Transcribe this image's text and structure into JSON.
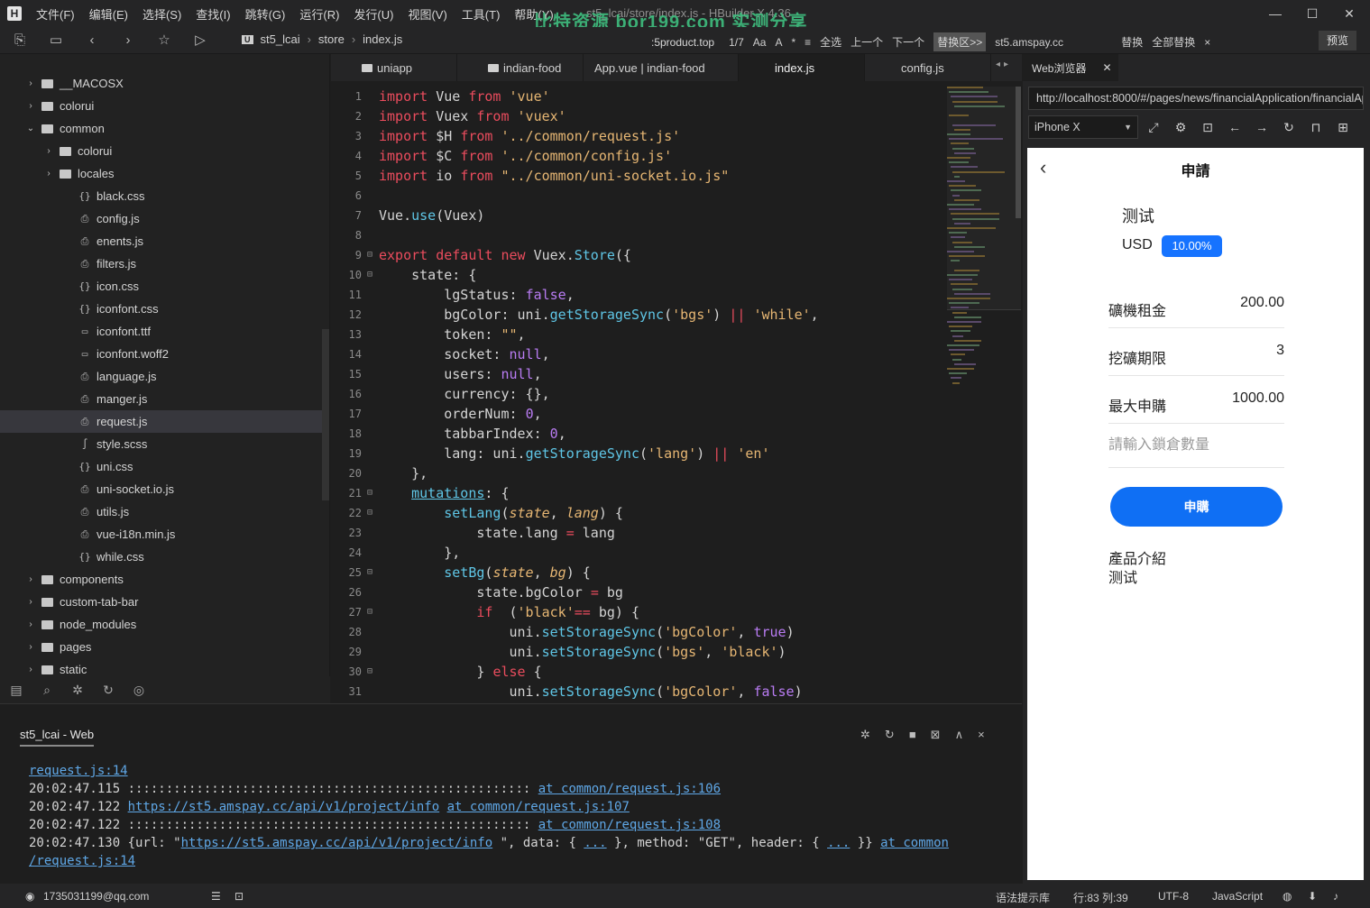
{
  "titlebar": {
    "app_logo": "H",
    "menus": [
      "文件(F)",
      "编辑(E)",
      "选择(S)",
      "查找(I)",
      "跳转(G)",
      "运行(R)",
      "发行(U)",
      "视图(V)",
      "工具(T)",
      "帮助(Y)"
    ],
    "window_title": "st5_lcai/store/index.js - HBuilder X 4.36",
    "watermark": "比特资源 bor199.com 实测分享"
  },
  "toolbar": {
    "breadcrumbs": [
      "st5_lcai",
      "store",
      "index.js"
    ],
    "find_term": ":5product.top",
    "find_count": "1/7",
    "case_btn": "Aa",
    "word_btn": "A",
    "regex_btn": "*",
    "select_all": "全选",
    "prev": "上一个",
    "next": "下一个",
    "replace_area": "替换区>>",
    "replace_term": "st5.amspay.cc",
    "replace": "替换",
    "replace_all": "全部替换",
    "close": "×",
    "preview": "预览"
  },
  "sidebar": {
    "items": [
      {
        "label": "__MACOSX",
        "type": "folder",
        "depth": 0,
        "expanded": false
      },
      {
        "label": "colorui",
        "type": "folder",
        "depth": 0,
        "expanded": false
      },
      {
        "label": "common",
        "type": "folder",
        "depth": 0,
        "expanded": true
      },
      {
        "label": "colorui",
        "type": "folder",
        "depth": 1,
        "expanded": false
      },
      {
        "label": "locales",
        "type": "folder",
        "depth": 1,
        "expanded": false
      },
      {
        "label": "black.css",
        "type": "css",
        "depth": 1
      },
      {
        "label": "config.js",
        "type": "js",
        "depth": 1
      },
      {
        "label": "enents.js",
        "type": "js",
        "depth": 1
      },
      {
        "label": "filters.js",
        "type": "js",
        "depth": 1
      },
      {
        "label": "icon.css",
        "type": "css",
        "depth": 1
      },
      {
        "label": "iconfont.css",
        "type": "css",
        "depth": 1
      },
      {
        "label": "iconfont.ttf",
        "type": "file",
        "depth": 1
      },
      {
        "label": "iconfont.woff2",
        "type": "file",
        "depth": 1
      },
      {
        "label": "language.js",
        "type": "js",
        "depth": 1
      },
      {
        "label": "manger.js",
        "type": "js",
        "depth": 1
      },
      {
        "label": "request.js",
        "type": "js",
        "depth": 1,
        "selected": true
      },
      {
        "label": "style.scss",
        "type": "scss",
        "depth": 1
      },
      {
        "label": "uni.css",
        "type": "css",
        "depth": 1
      },
      {
        "label": "uni-socket.io.js",
        "type": "js",
        "depth": 1
      },
      {
        "label": "utils.js",
        "type": "js",
        "depth": 1
      },
      {
        "label": "vue-i18n.min.js",
        "type": "js",
        "depth": 1
      },
      {
        "label": "while.css",
        "type": "css",
        "depth": 1
      },
      {
        "label": "components",
        "type": "folder",
        "depth": 0,
        "expanded": false
      },
      {
        "label": "custom-tab-bar",
        "type": "folder",
        "depth": 0,
        "expanded": false
      },
      {
        "label": "node_modules",
        "type": "folder",
        "depth": 0,
        "expanded": false
      },
      {
        "label": "pages",
        "type": "folder",
        "depth": 0,
        "expanded": false
      },
      {
        "label": "static",
        "type": "folder",
        "depth": 0,
        "expanded": false
      }
    ]
  },
  "tabs": [
    {
      "label": "uniapp",
      "folder": true
    },
    {
      "label": "indian-food",
      "folder": true
    },
    {
      "label": "App.vue | indian-food",
      "folder": false
    },
    {
      "label": "index.js",
      "folder": false,
      "active": true
    },
    {
      "label": "config.js",
      "folder": false
    }
  ],
  "code": [
    {
      "n": "1",
      "fold": "",
      "tokens": [
        [
          "kw",
          "import"
        ],
        [
          "",
          "Vue "
        ],
        [
          "kw",
          "from"
        ],
        [
          "",
          ""
        ],
        [
          "str",
          "'vue'"
        ]
      ]
    },
    {
      "n": "2",
      "fold": "",
      "tokens": [
        [
          "kw",
          "import"
        ],
        [
          "",
          "Vuex "
        ],
        [
          "kw",
          "from"
        ],
        [
          "",
          ""
        ],
        [
          "str",
          "'vuex'"
        ]
      ]
    },
    {
      "n": "3",
      "fold": "",
      "tokens": [
        [
          "kw",
          "import"
        ],
        [
          "",
          "$H "
        ],
        [
          "kw",
          "from"
        ],
        [
          "",
          ""
        ],
        [
          "str",
          "'../common/request.js'"
        ]
      ]
    },
    {
      "n": "4",
      "fold": "",
      "tokens": [
        [
          "kw",
          "import"
        ],
        [
          "",
          "$C "
        ],
        [
          "kw",
          "from"
        ],
        [
          "",
          ""
        ],
        [
          "str",
          "'../common/config.js'"
        ]
      ]
    },
    {
      "n": "5",
      "fold": "",
      "tokens": [
        [
          "kw",
          "import"
        ],
        [
          "",
          "io "
        ],
        [
          "kw",
          "from"
        ],
        [
          "",
          ""
        ],
        [
          "str",
          "\"../common/uni-socket.io.js\""
        ]
      ]
    },
    {
      "n": "6",
      "fold": "",
      "tokens": []
    },
    {
      "n": "7",
      "fold": "",
      "tokens": [
        [
          "",
          "Vue."
        ],
        [
          "fn",
          "use"
        ],
        [
          "",
          "(Vuex)"
        ]
      ]
    },
    {
      "n": "8",
      "fold": "",
      "tokens": []
    },
    {
      "n": "9",
      "fold": "⊟",
      "tokens": [
        [
          "kw",
          "export default new"
        ],
        [
          "",
          "Vuex."
        ],
        [
          "fn",
          "Store"
        ],
        [
          "",
          "({"
        ]
      ]
    },
    {
      "n": "10",
      "fold": "⊟",
      "tokens": [
        [
          "",
          "    state: {"
        ]
      ]
    },
    {
      "n": "11",
      "fold": "",
      "tokens": [
        [
          "",
          "        lgStatus: "
        ],
        [
          "lit",
          "false"
        ],
        [
          "",
          ","
        ]
      ]
    },
    {
      "n": "12",
      "fold": "",
      "tokens": [
        [
          "",
          "        bgColor: uni."
        ],
        [
          "fn",
          "getStorageSync"
        ],
        [
          "",
          "("
        ],
        [
          "str",
          "'bgs'"
        ],
        [
          "",
          ") "
        ],
        [
          "op",
          "||"
        ],
        [
          "",
          ""
        ],
        [
          "str",
          "'while'"
        ],
        [
          "",
          ","
        ]
      ]
    },
    {
      "n": "13",
      "fold": "",
      "tokens": [
        [
          "",
          "        token: "
        ],
        [
          "str",
          "\"\""
        ],
        [
          "",
          ","
        ]
      ]
    },
    {
      "n": "14",
      "fold": "",
      "tokens": [
        [
          "",
          "        socket: "
        ],
        [
          "lit",
          "null"
        ],
        [
          "",
          ","
        ]
      ]
    },
    {
      "n": "15",
      "fold": "",
      "tokens": [
        [
          "",
          "        users: "
        ],
        [
          "lit",
          "null"
        ],
        [
          "",
          ","
        ]
      ]
    },
    {
      "n": "16",
      "fold": "",
      "tokens": [
        [
          "",
          "        currency: {},"
        ]
      ]
    },
    {
      "n": "17",
      "fold": "",
      "tokens": [
        [
          "",
          "        orderNum: "
        ],
        [
          "lit",
          "0"
        ],
        [
          "",
          ","
        ]
      ]
    },
    {
      "n": "18",
      "fold": "",
      "tokens": [
        [
          "",
          "        tabbarIndex: "
        ],
        [
          "lit",
          "0"
        ],
        [
          "",
          ","
        ]
      ]
    },
    {
      "n": "19",
      "fold": "",
      "tokens": [
        [
          "",
          "        lang: uni."
        ],
        [
          "fn",
          "getStorageSync"
        ],
        [
          "",
          "("
        ],
        [
          "str",
          "'lang'"
        ],
        [
          "",
          ") "
        ],
        [
          "op",
          "||"
        ],
        [
          "",
          ""
        ],
        [
          "str",
          "'en'"
        ]
      ]
    },
    {
      "n": "20",
      "fold": "",
      "tokens": [
        [
          "",
          "    },"
        ]
      ]
    },
    {
      "n": "21",
      "fold": "⊟",
      "tokens": [
        [
          "",
          "    "
        ],
        [
          "link",
          "mutations"
        ],
        [
          "",
          ": {"
        ]
      ]
    },
    {
      "n": "22",
      "fold": "⊟",
      "tokens": [
        [
          "",
          "        "
        ],
        [
          "fn",
          "setLang"
        ],
        [
          "",
          "("
        ],
        [
          "param",
          "state"
        ],
        [
          "",
          ", "
        ],
        [
          "param",
          "lang"
        ],
        [
          "",
          ") {"
        ]
      ]
    },
    {
      "n": "23",
      "fold": "",
      "tokens": [
        [
          "",
          "            state.lang "
        ],
        [
          "op",
          "="
        ],
        [
          "",
          ""
        ],
        [
          "",
          "lang"
        ]
      ]
    },
    {
      "n": "24",
      "fold": "",
      "tokens": [
        [
          "",
          "        },"
        ]
      ]
    },
    {
      "n": "25",
      "fold": "⊟",
      "tokens": [
        [
          "",
          "        "
        ],
        [
          "fn",
          "setBg"
        ],
        [
          "",
          "("
        ],
        [
          "param",
          "state"
        ],
        [
          "",
          ", "
        ],
        [
          "param",
          "bg"
        ],
        [
          "",
          ") {"
        ]
      ]
    },
    {
      "n": "26",
      "fold": "",
      "tokens": [
        [
          "",
          "            state.bgColor "
        ],
        [
          "op",
          "="
        ],
        [
          "",
          ""
        ],
        [
          "",
          "bg"
        ]
      ]
    },
    {
      "n": "27",
      "fold": "⊟",
      "tokens": [
        [
          "",
          "            "
        ],
        [
          "kw",
          "if"
        ],
        [
          "",
          " ("
        ],
        [
          "str",
          "'black'"
        ],
        [
          "",
          ""
        ],
        [
          "op",
          "=="
        ],
        [
          "",
          ""
        ],
        [
          "",
          "bg) {"
        ]
      ]
    },
    {
      "n": "28",
      "fold": "",
      "tokens": [
        [
          "",
          "                uni."
        ],
        [
          "fn",
          "setStorageSync"
        ],
        [
          "",
          "("
        ],
        [
          "str",
          "'bgColor'"
        ],
        [
          "",
          ", "
        ],
        [
          "lit",
          "true"
        ],
        [
          "",
          ")"
        ]
      ]
    },
    {
      "n": "29",
      "fold": "",
      "tokens": [
        [
          "",
          "                uni."
        ],
        [
          "fn",
          "setStorageSync"
        ],
        [
          "",
          "("
        ],
        [
          "str",
          "'bgs'"
        ],
        [
          "",
          ", "
        ],
        [
          "str",
          "'black'"
        ],
        [
          "",
          ")"
        ]
      ]
    },
    {
      "n": "30",
      "fold": "⊟",
      "tokens": [
        [
          "",
          "            } "
        ],
        [
          "kw",
          "else"
        ],
        [
          "",
          ""
        ],
        [
          "",
          "{"
        ]
      ]
    },
    {
      "n": "31",
      "fold": "",
      "tokens": [
        [
          "",
          "                uni."
        ],
        [
          "fn",
          "setStorageSync"
        ],
        [
          "",
          "("
        ],
        [
          "str",
          "'bgColor'"
        ],
        [
          "",
          ", "
        ],
        [
          "lit",
          "false"
        ],
        [
          "",
          ")"
        ]
      ]
    }
  ],
  "console": {
    "tab": "st5_lcai - Web",
    "lines": [
      [
        [
          "link",
          "request.js:14"
        ]
      ],
      [
        [
          "",
          "20:02:47.115 ::::::::::::::::::::::::::::::::::::::::::::::::::::: "
        ],
        [
          "link",
          "at common/request.js:106"
        ]
      ],
      [
        [
          "",
          "20:02:47.122 "
        ],
        [
          "link",
          "https://st5.amspay.cc/api/v1/project/info"
        ],
        [
          "",
          ""
        ],
        [
          "link",
          "at common/request.js:107"
        ]
      ],
      [
        [
          "",
          "20:02:47.122 ::::::::::::::::::::::::::::::::::::::::::::::::::::: "
        ],
        [
          "link",
          "at common/request.js:108"
        ]
      ],
      [
        [
          "",
          "20:02:47.130 {url: \""
        ],
        [
          "link",
          "https://st5.amspay.cc/api/v1/project/info"
        ],
        [
          "",
          "\", data: { "
        ],
        [
          "link",
          "..."
        ],
        [
          "",
          ""
        ],
        [
          "",
          "}, method: \"GET\", header: { "
        ],
        [
          "link",
          "..."
        ],
        [
          "",
          ""
        ],
        [
          "",
          "}} "
        ],
        [
          "link",
          "at common"
        ]
      ],
      [
        [
          "link",
          "/request.js:14"
        ]
      ]
    ]
  },
  "statusbar": {
    "account": "1735031199@qq.com",
    "syntax_hint": "语法提示库",
    "position": "行:83  列:39",
    "encoding": "UTF-8",
    "language": "JavaScript"
  },
  "browser": {
    "tab": "Web浏览器",
    "url": "http://localhost:8000/#/pages/news/financialApplication/financialApplication",
    "device": "iPhone X",
    "page": {
      "title": "申請",
      "product_name": "测试",
      "currency": "USD",
      "rate": "10.00%",
      "rows": [
        {
          "label": "礦機租金",
          "value": "200.00"
        },
        {
          "label": "挖礦期限",
          "value": "3"
        },
        {
          "label": "最大申購",
          "value": "1000.00"
        }
      ],
      "qty_placeholder": "請輸入鎖倉數量",
      "qty_value": "",
      "buy_label": "申購",
      "intro_title": "產品介紹",
      "intro_text": "测试"
    }
  }
}
